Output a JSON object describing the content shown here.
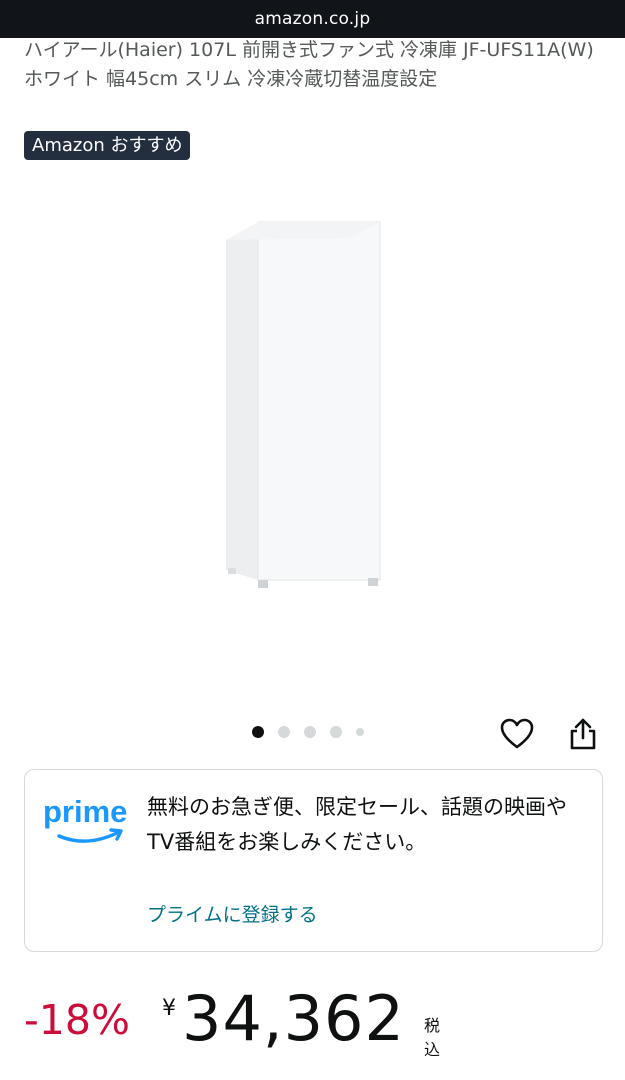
{
  "browser": {
    "url": "amazon.co.jp"
  },
  "product": {
    "title": "ハイアール(Haier) 107L 前開き式ファン式 冷凍庫 JF-UFS11A(W) ホワイト 幅45cm スリム 冷凍冷蔵切替温度設定",
    "badge": "Amazon おすすめ",
    "image_alt_icon": "freezer-product-image"
  },
  "carousel": {
    "dot_count": 5,
    "active_index": 0
  },
  "actions": {
    "favorite_icon": "heart-icon",
    "share_icon": "share-icon"
  },
  "prime": {
    "logo_text": "prime",
    "description": "無料のお急ぎ便、限定セール、話題の映画やTV番組をお楽しみください。",
    "link": "プライムに登録する"
  },
  "pricing": {
    "discount": "-18%",
    "currency": "¥",
    "price": "34,362",
    "tax_label": "税込"
  },
  "colors": {
    "url_bar_bg": "#111418",
    "badge_bg": "#232f3e",
    "discount_red": "#cc0c39",
    "link_teal": "#007185",
    "prime_blue": "#1a98ff"
  }
}
